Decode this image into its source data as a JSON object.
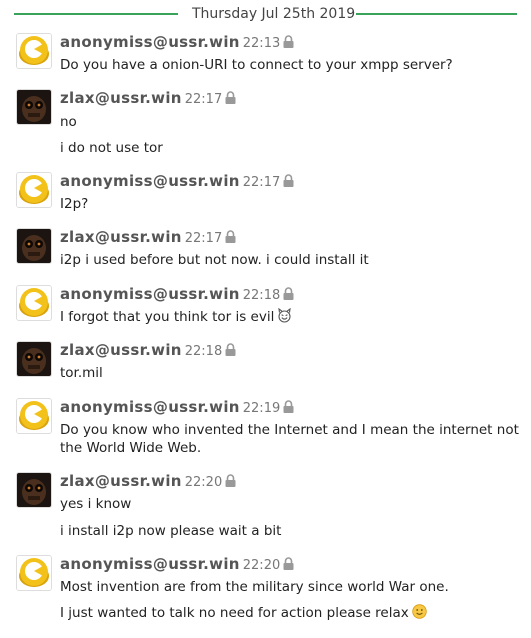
{
  "date_separator": "Thursday Jul 25th 2019",
  "messages": [
    {
      "author": "anonymiss@ussr.win",
      "time": "22:13",
      "lines": [
        "Do you have a onion-URI to connect to your xmpp server?"
      ]
    },
    {
      "author": "zlax@ussr.win",
      "time": "22:17",
      "lines": [
        "no",
        "i do not use tor"
      ]
    },
    {
      "author": "anonymiss@ussr.win",
      "time": "22:17",
      "lines": [
        "I2p?"
      ]
    },
    {
      "author": "zlax@ussr.win",
      "time": "22:17",
      "lines": [
        "i2p i used before but not now. i could install it"
      ]
    },
    {
      "author": "anonymiss@ussr.win",
      "time": "22:18",
      "lines": [
        "I forgot that you think tor is evil"
      ]
    },
    {
      "author": "zlax@ussr.win",
      "time": "22:18",
      "lines": [
        "tor.mil"
      ]
    },
    {
      "author": "anonymiss@ussr.win",
      "time": "22:19",
      "lines": [
        "Do you know who invented the Internet and I mean the internet not the World Wide Web."
      ]
    },
    {
      "author": "zlax@ussr.win",
      "time": "22:20",
      "lines": [
        "yes i know",
        "i install i2p now please wait a bit"
      ]
    },
    {
      "author": "anonymiss@ussr.win",
      "time": "22:20",
      "lines": [
        "Most invention are from the military since world War one.",
        "I just wanted to talk no need for action please relax"
      ]
    }
  ],
  "icons": {
    "encryption": "lock-icon",
    "emoji_evil": "smiling-imp-emoji",
    "emoji_smile": "slightly-smiling-emoji"
  },
  "colors": {
    "separator": "#3aa35a",
    "avatar_yellow": "#f2c21a"
  }
}
